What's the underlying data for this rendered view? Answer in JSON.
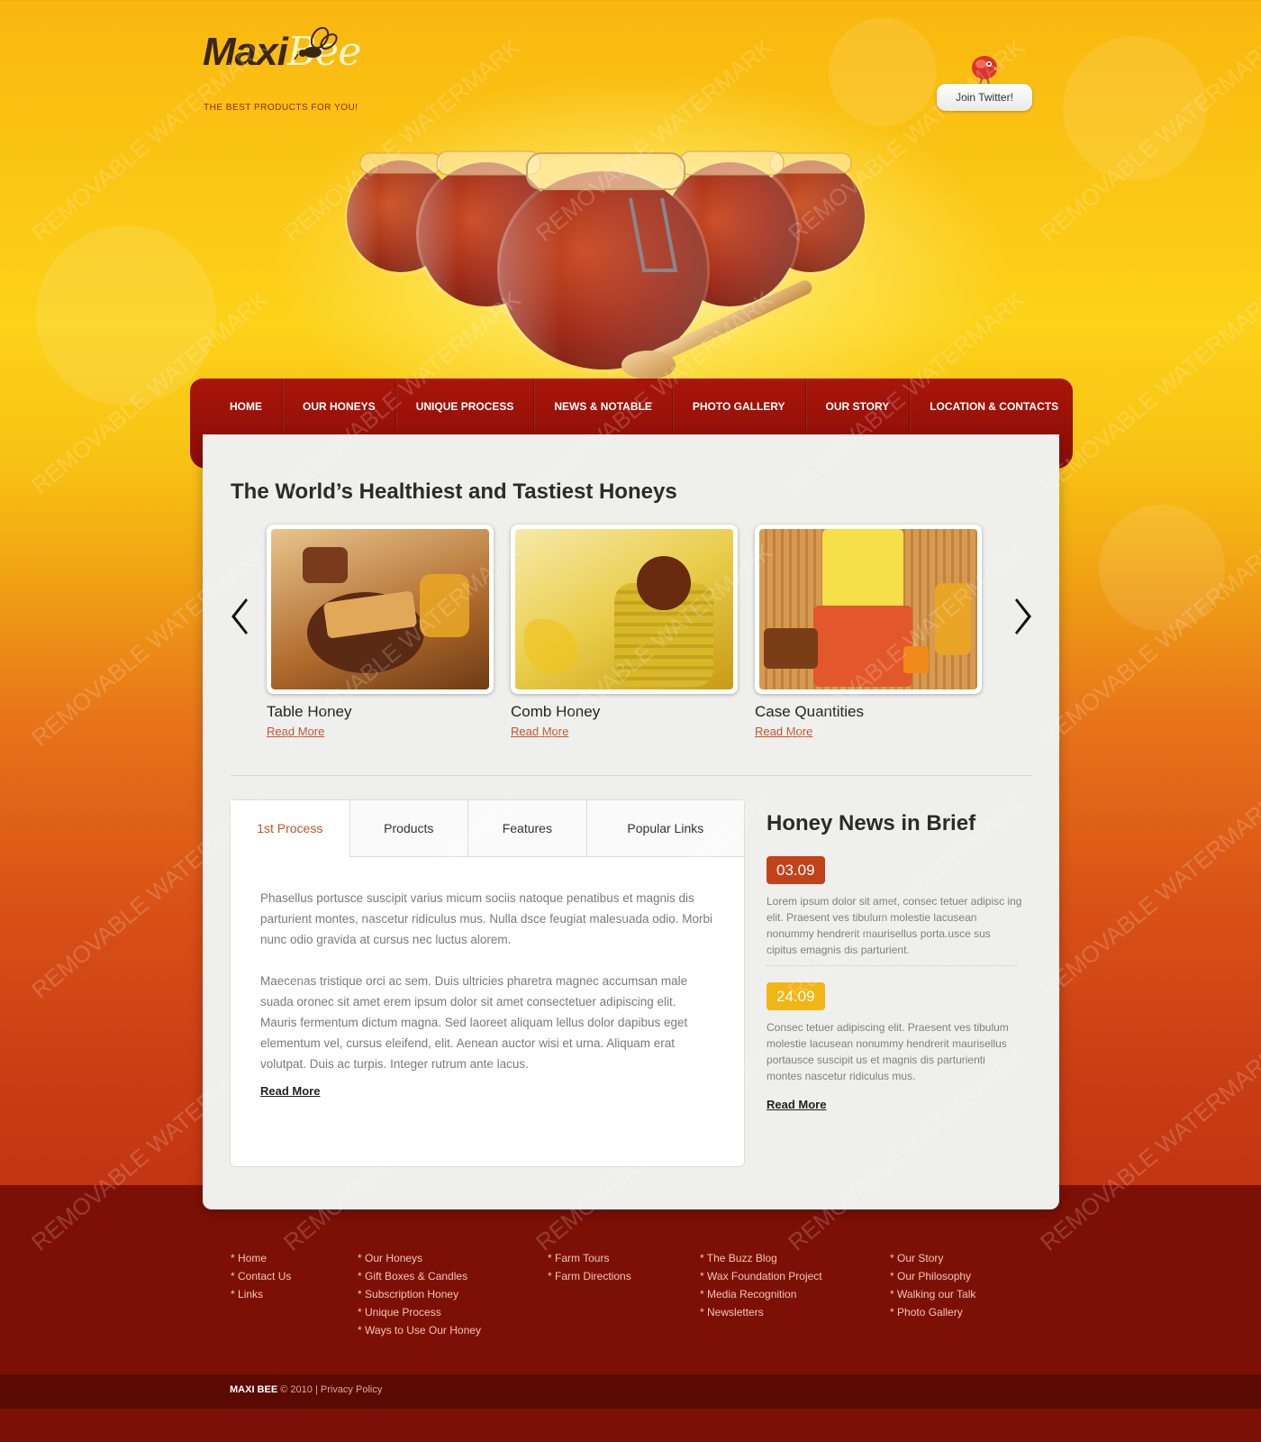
{
  "brand": {
    "name_part1": "Maxi",
    "name_part2": "Bee",
    "tagline": "THE BEST PRODUCTS FOR YOU!"
  },
  "twitter": {
    "label": "Join Twitter!"
  },
  "nav": {
    "items": [
      {
        "label": "HOME"
      },
      {
        "label": "OUR HONEYS"
      },
      {
        "label": "UNIQUE PROCESS"
      },
      {
        "label": "NEWS & NOTABLE"
      },
      {
        "label": "PHOTO GALLERY"
      },
      {
        "label": "OUR STORY"
      },
      {
        "label": "LOCATION & CONTACTS"
      }
    ]
  },
  "main": {
    "title": "The World’s Healthiest and Tastiest Honeys",
    "cards": [
      {
        "title": "Table Honey",
        "link": "Read More"
      },
      {
        "title": "Comb Honey",
        "link": "Read More"
      },
      {
        "title": "Case Quantities",
        "link": "Read More"
      }
    ]
  },
  "tabs": {
    "items": [
      {
        "label": "1st Process"
      },
      {
        "label": "Products"
      },
      {
        "label": "Features"
      },
      {
        "label": "Popular Links"
      }
    ],
    "paragraphs": [
      "Phasellus portusce suscipit varius micum sociis natoque penatibus et magnis dis parturient montes, nascetur ridiculus mus. Nulla dsce feugiat malesuada odio. Morbi nunc odio gravida at cursus nec luctus alorem.",
      "Maecenas tristique orci ac sem. Duis ultricies pharetra magnec accumsan male suada oronec sit amet erem ipsum dolor sit amet consectetuer adipiscing elit. Mauris fermentum dictum magna. Sed laoreet aliquam lellus dolor dapibus eget elementum vel, cursus eleifend, elit. Aenean auctor wisi et urna. Aliquam erat volutpat. Duis ac turpis. Integer rutrum ante lacus."
    ],
    "read_more": "Read More"
  },
  "news": {
    "title": "Honey News in Brief",
    "items": [
      {
        "date": "03.09",
        "text": "Lorem ipsum dolor sit amet, consec tetuer adipisc ing elit. Praesent ves tibulum molestie lacusean nonummy hendrerit maurisellus porta.usce sus cipitus emagnis dis parturient."
      },
      {
        "date": "24.09",
        "text": "Consec tetuer adipiscing elit. Praesent ves tibulum molestie lacusean nonummy hendrerit maurisellus portausce suscipit us et magnis dis parturienti montes nascetur ridiculus mus."
      }
    ],
    "read_more": "Read More"
  },
  "footer": {
    "columns": [
      [
        "Home",
        "Contact Us",
        "Links"
      ],
      [
        "Our Honeys",
        "Gift Boxes & Candles",
        "Subscription Honey",
        "Unique Process",
        "Ways to Use Our Honey"
      ],
      [
        "Farm Tours",
        "Farm Directions"
      ],
      [
        "The Buzz Blog",
        "Wax Foundation Project",
        "Media Recognition",
        "Newsletters"
      ],
      [
        "Our Story",
        "Our Philosophy",
        "Walking our Talk",
        "Photo Gallery"
      ]
    ],
    "brand": "MAXI BEE",
    "copyright": "© 2010",
    "separator": "|",
    "privacy": "Privacy Policy"
  },
  "watermark": "REMOVABLE WATERMARK",
  "colors": {
    "nav_red": "#a8150a",
    "accent_orange": "#c0542a",
    "date_red": "#c2421a",
    "date_yellow": "#f2b614",
    "footer_bg": "#7d1006"
  }
}
